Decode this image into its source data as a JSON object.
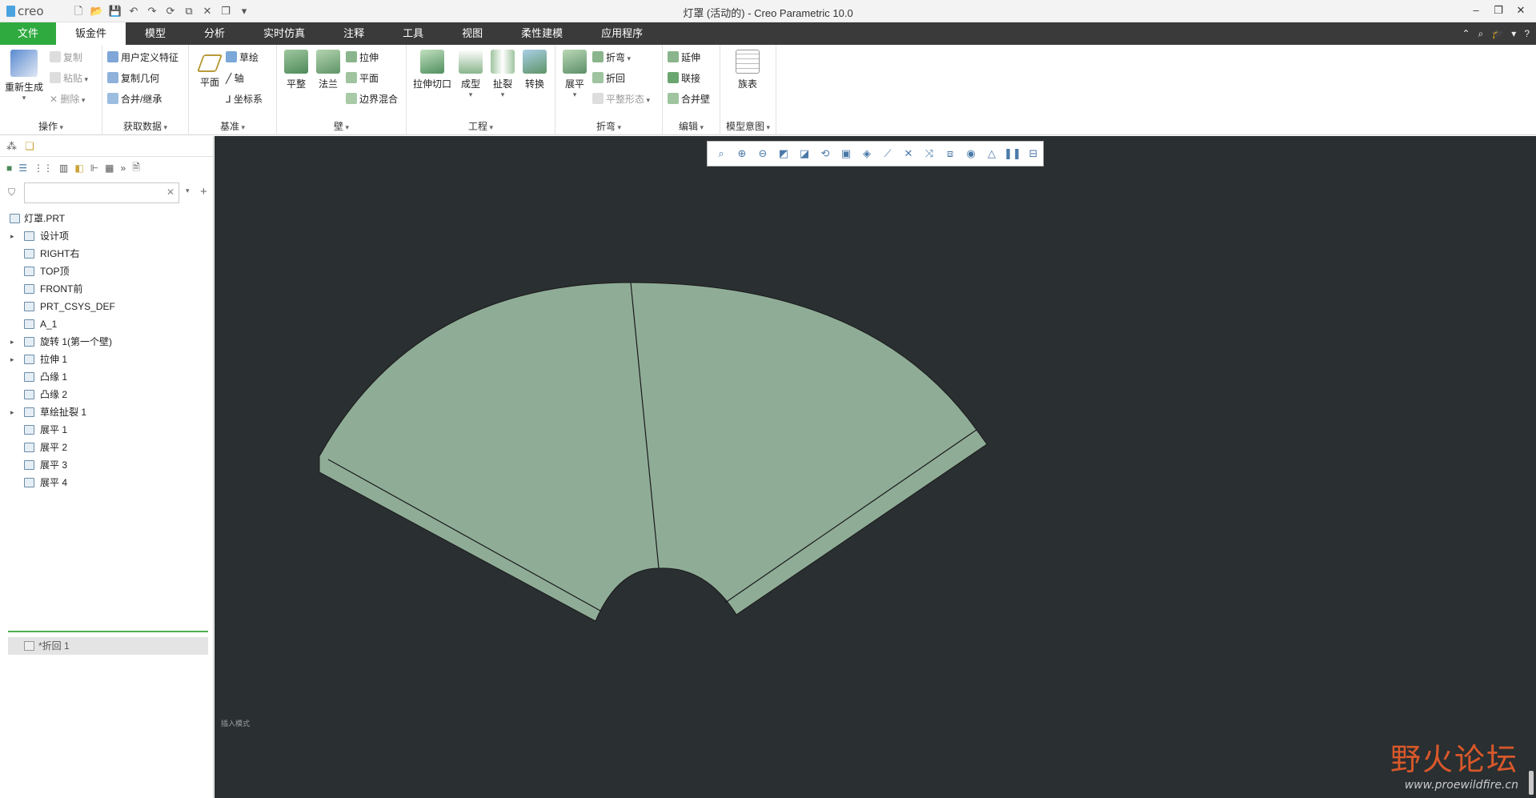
{
  "app": {
    "logo": "creo",
    "window_title": "灯罩 (活动的) - Creo Parametric 10.0"
  },
  "tabs": [
    "文件",
    "钣金件",
    "模型",
    "分析",
    "实时仿真",
    "注释",
    "工具",
    "视图",
    "柔性建模",
    "应用程序"
  ],
  "ribbon": {
    "groups": {
      "operations": {
        "label": "操作",
        "regenerate": "重新生成",
        "copy": "复制",
        "paste": "粘贴",
        "delete": "删除"
      },
      "get_data": {
        "label": "获取数据",
        "udf": "用户定义特征",
        "copy_geom": "复制几何",
        "merge": "合并/继承"
      },
      "datum": {
        "label": "基准",
        "plane": "平面",
        "sketch": "草绘",
        "axis": "轴",
        "csys": "坐标系"
      },
      "walls": {
        "label": "壁",
        "planar": "平整",
        "flange": "法兰",
        "extrude": "拉伸",
        "flat": "平面",
        "blend": "边界混合"
      },
      "engineering": {
        "label": "工程",
        "extrude_cut": "拉伸切口",
        "form": "成型",
        "rip": "扯裂",
        "convert": "转换"
      },
      "bends": {
        "label": "折弯",
        "unbend": "展平",
        "bend": "折弯",
        "bend_back": "折回",
        "flat_state": "平整形态"
      },
      "editing": {
        "label": "编辑",
        "extend": "延伸",
        "join": "联接",
        "merge_walls": "合并壁"
      },
      "model_intent": {
        "label": "模型意图",
        "family_table": "族表"
      }
    }
  },
  "tree": {
    "search_placeholder": "",
    "items": [
      {
        "label": "灯罩.PRT",
        "expandable": false,
        "level": 0
      },
      {
        "label": "设计项",
        "expandable": true,
        "level": 1
      },
      {
        "label": "RIGHT右",
        "expandable": false,
        "level": 1
      },
      {
        "label": "TOP顶",
        "expandable": false,
        "level": 1
      },
      {
        "label": "FRONT前",
        "expandable": false,
        "level": 1
      },
      {
        "label": "PRT_CSYS_DEF",
        "expandable": false,
        "level": 1
      },
      {
        "label": "A_1",
        "expandable": false,
        "level": 1
      },
      {
        "label": "旋转 1(第一个壁)",
        "expandable": true,
        "level": 1
      },
      {
        "label": "拉伸 1",
        "expandable": true,
        "level": 1
      },
      {
        "label": "凸缘 1",
        "expandable": false,
        "level": 1
      },
      {
        "label": "凸缘 2",
        "expandable": false,
        "level": 1
      },
      {
        "label": "草绘扯裂 1",
        "expandable": true,
        "level": 1
      },
      {
        "label": "展平 1",
        "expandable": false,
        "level": 1
      },
      {
        "label": "展平 2",
        "expandable": false,
        "level": 1
      },
      {
        "label": "展平 3",
        "expandable": false,
        "level": 1
      },
      {
        "label": "展平 4",
        "expandable": false,
        "level": 1
      }
    ],
    "pending_item": "*折回 1"
  },
  "graphics": {
    "background": "#2a2f31",
    "part_color": "#8fac97",
    "edge_color": "#1a1a1a",
    "status_hint": "插入模式"
  },
  "watermark": {
    "main": "野火论坛",
    "sub": "www.proewildfire.cn",
    "color": "#d9582a"
  }
}
